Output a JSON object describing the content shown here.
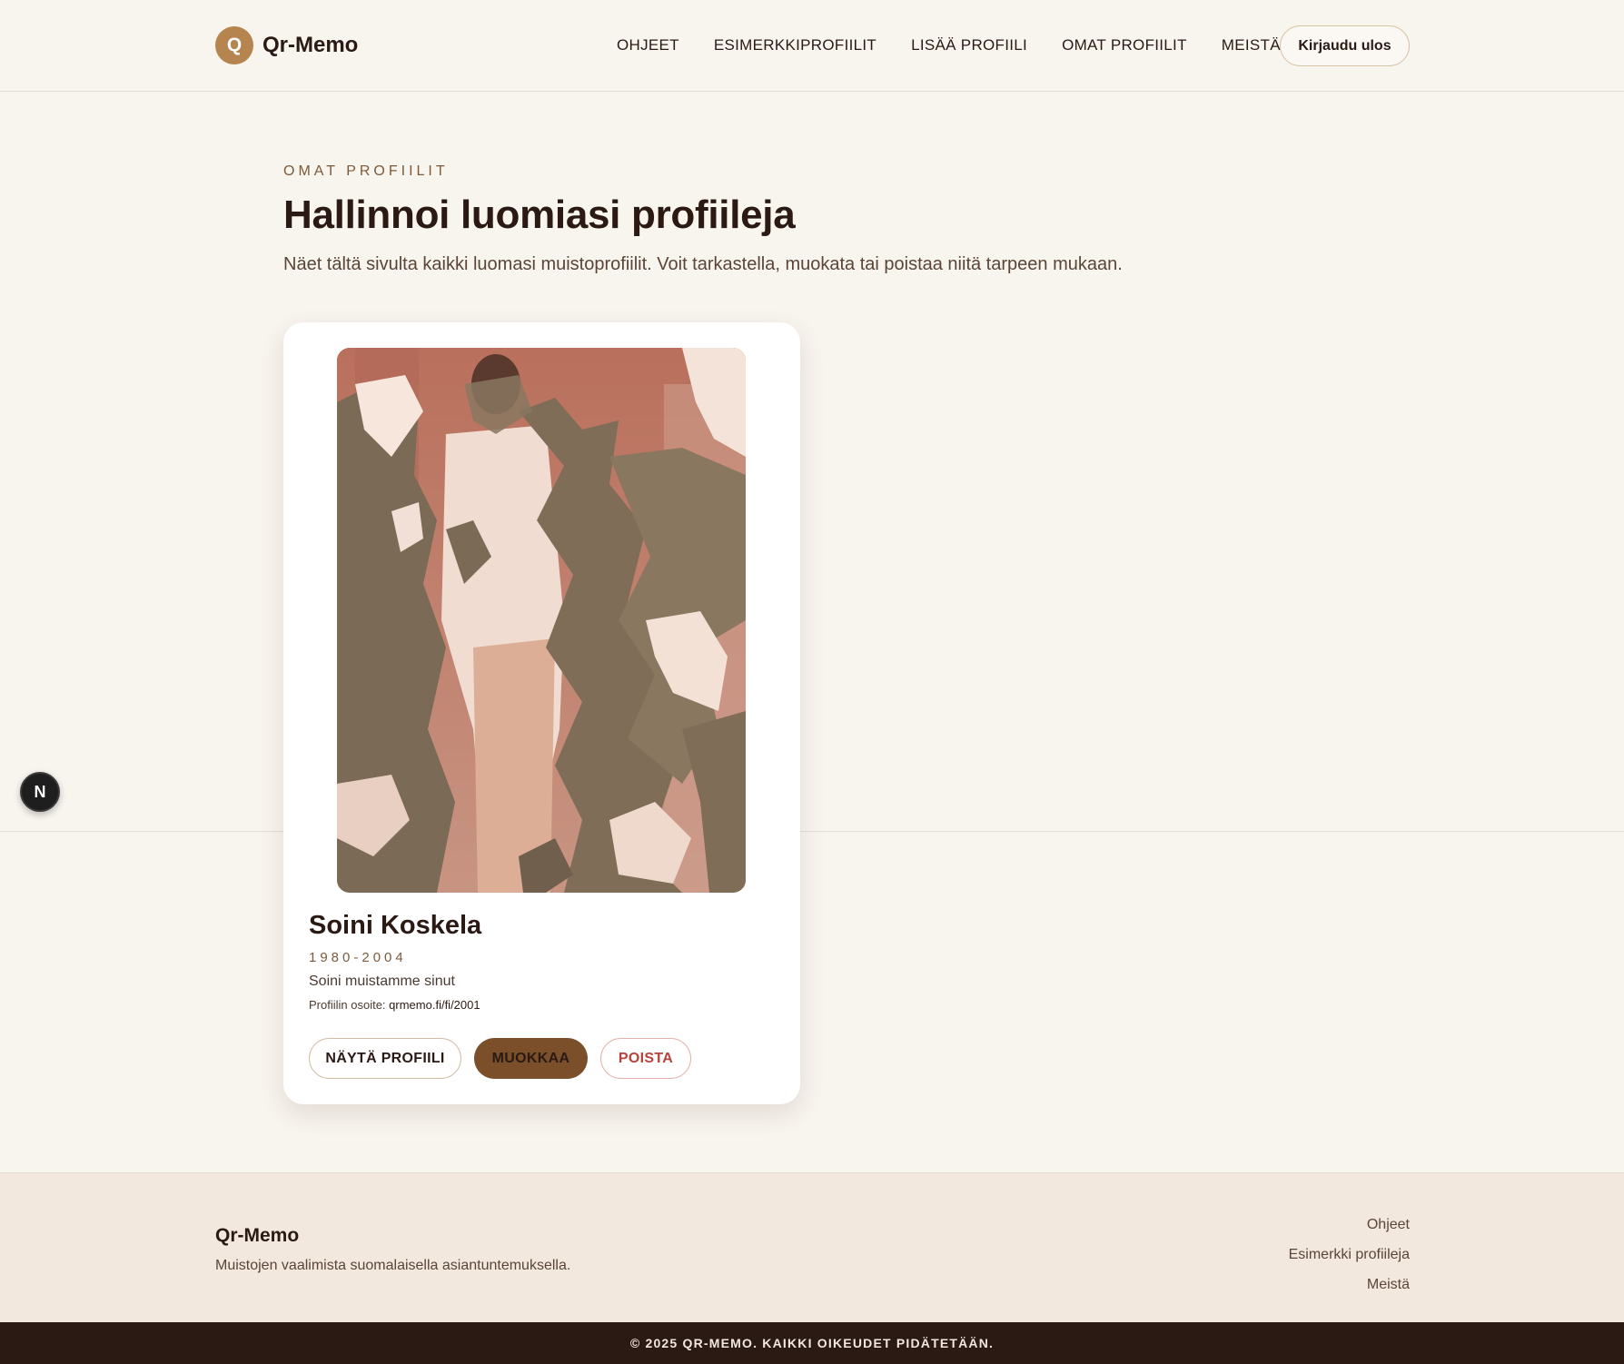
{
  "header": {
    "logo_letter": "Q",
    "logo_text": "Qr-Memo",
    "nav": [
      "OHJEET",
      "ESIMERKKIPROFIILIT",
      "LISÄÄ PROFIILI",
      "OMAT PROFIILIT",
      "MEISTÄ"
    ],
    "logout_label": "Kirjaudu ulos"
  },
  "main": {
    "eyebrow": "OMAT PROFIILIT",
    "title": "Hallinnoi luomiasi profiileja",
    "description": "Näet tältä sivulta kaikki luomasi muistoprofiilit. Voit tarkastella, muokata tai poistaa niitä tarpeen mukaan."
  },
  "profiles": [
    {
      "name": "Soini Koskela",
      "years": "1980-2004",
      "message": "Soini muistamme sinut",
      "url_label": "Profiilin osoite:",
      "url_value": "qrmemo.fi/fi/2001",
      "buttons": {
        "view": "NÄYTÄ PROFIILI",
        "edit": "MUOKKAA",
        "delete": "POISTA"
      }
    }
  ],
  "floating_badge": "N",
  "footer": {
    "brand": "Qr-Memo",
    "tagline": "Muistojen vaalimista suomalaisella asiantuntemuksella.",
    "links": [
      "Ohjeet",
      "Esimerkki profiileja",
      "Meistä"
    ],
    "copyright": "© 2025 QR-MEMO. KAIKKI OIKEUDET PIDÄTETÄÄN."
  },
  "colors": {
    "background": "#f8f4ee",
    "accent": "#b6844e",
    "edit_button": "#7a4f2a",
    "delete": "#b6443c",
    "dark": "#2b1a14"
  }
}
